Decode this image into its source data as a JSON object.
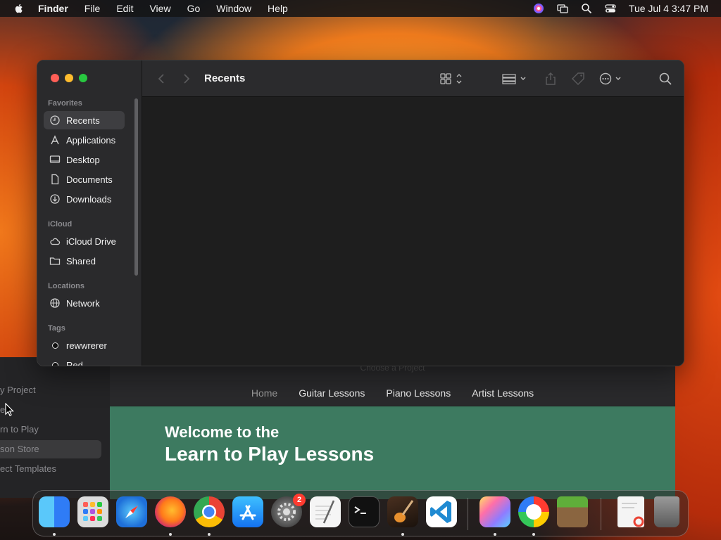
{
  "menubar": {
    "app_name": "Finder",
    "items": [
      "File",
      "Edit",
      "View",
      "Go",
      "Window",
      "Help"
    ],
    "clock": "Tue Jul 4  3:47 PM"
  },
  "finder": {
    "title": "Recents",
    "sidebar": {
      "favorites_header": "Favorites",
      "favorites": [
        "Recents",
        "Applications",
        "Desktop",
        "Documents",
        "Downloads"
      ],
      "icloud_header": "iCloud",
      "icloud": [
        "iCloud Drive",
        "Shared"
      ],
      "locations_header": "Locations",
      "locations": [
        "Network"
      ],
      "tags_header": "Tags",
      "tags": [
        "rewwrerer",
        "Red"
      ]
    }
  },
  "background_app": {
    "sidebar_items": [
      "y Project",
      "e",
      "rn to Play",
      "son Store",
      "ect Templates"
    ],
    "choose_text": "Choose a Project",
    "web_nav": [
      "Home",
      "Guitar Lessons",
      "Piano Lessons",
      "Artist Lessons"
    ],
    "hero_line1": "Welcome to the",
    "hero_line2": "Learn to Play Lessons"
  },
  "dock": {
    "apps": [
      "finder",
      "launchpad",
      "safari",
      "firefox",
      "chrome",
      "app-store",
      "system-settings",
      "textedit",
      "terminal",
      "garageband",
      "vscode",
      "gradient-app",
      "color-app",
      "minecraft",
      "document",
      "trash"
    ],
    "settings_badge": "2"
  },
  "colors": {
    "accent_red": "#ff5f57",
    "accent_yellow": "#febc2e",
    "accent_green": "#28c840",
    "hero_green": "#3d7a60"
  }
}
